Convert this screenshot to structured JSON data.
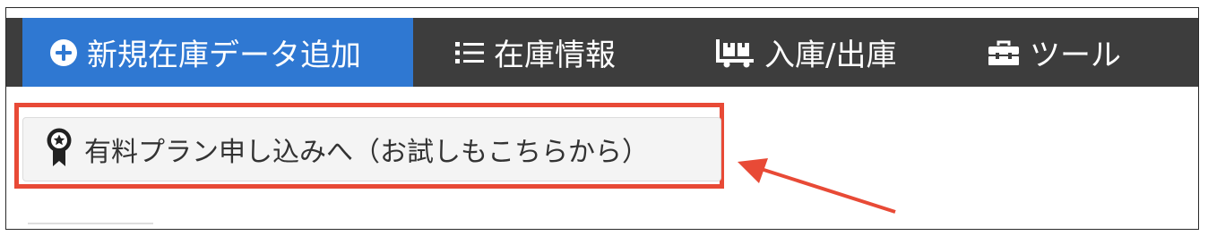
{
  "nav": {
    "new_label": "新規在庫データ追加",
    "info_label": "在庫情報",
    "stock_label": "入庫/出庫",
    "tools_label": "ツール"
  },
  "plan_button": {
    "label": "有料プラン申し込みへ（お試しもこちらから）"
  },
  "colors": {
    "navbar_bg": "#3d3d3d",
    "active_bg": "#2f78d2",
    "highlight": "#e84a36",
    "button_bg": "#f4f4f4"
  },
  "icons": {
    "new": "plus-circle-icon",
    "info": "list-icon",
    "stock": "dolly-icon",
    "tools": "toolbox-icon",
    "plan": "award-ribbon-icon",
    "annotation": "arrow-icon"
  }
}
